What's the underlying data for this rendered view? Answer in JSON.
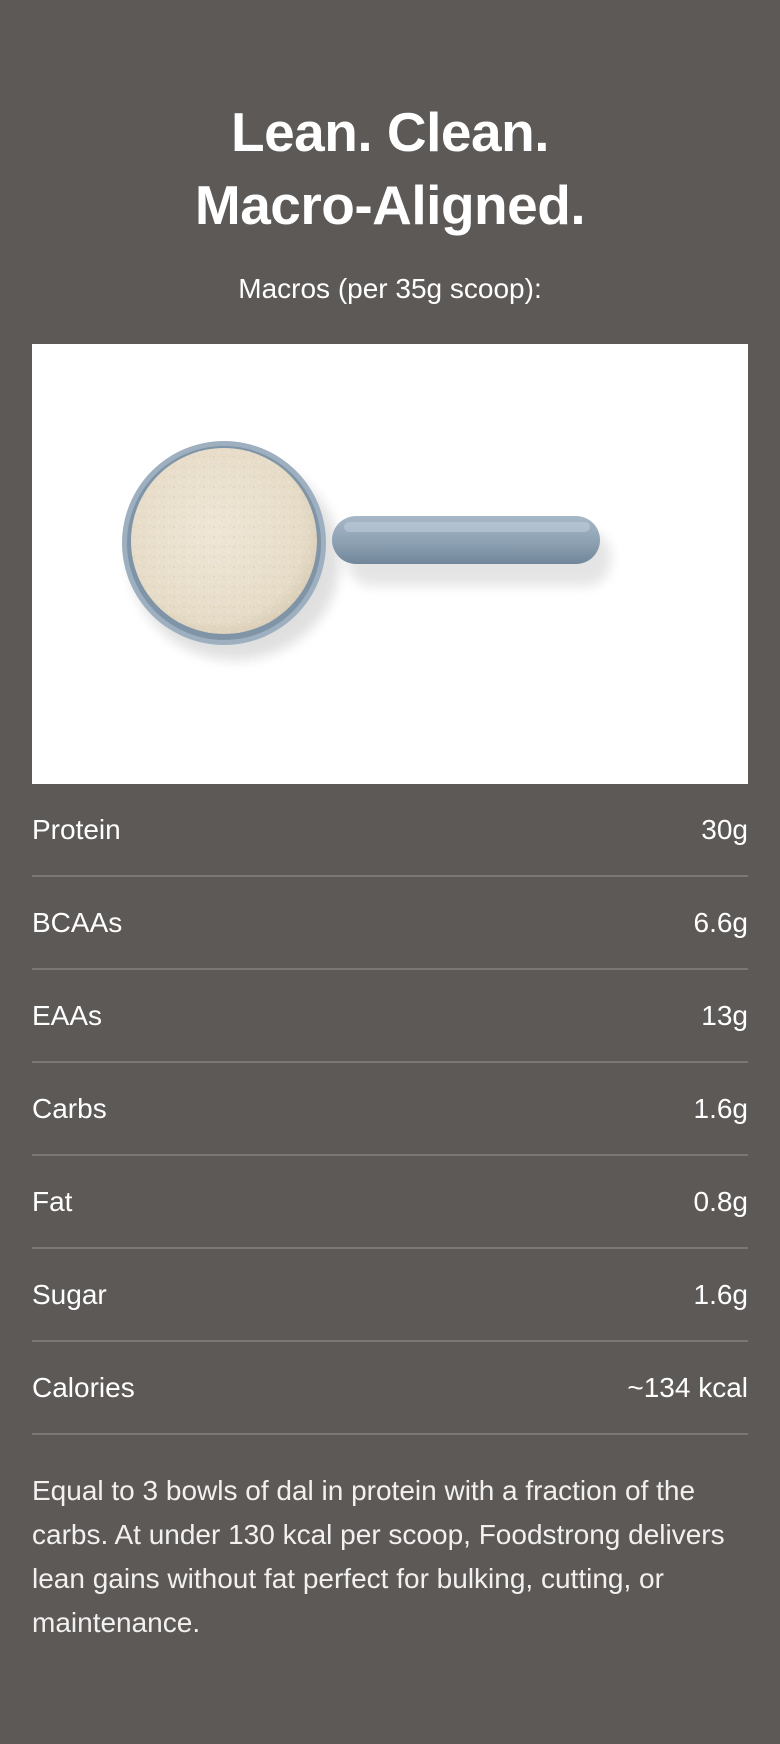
{
  "heading": {
    "line1": "Lean. Clean.",
    "line2": "Macro-Aligned."
  },
  "subheading": "Macros (per 35g scoop):",
  "image": {
    "icon": "protein-scoop-icon",
    "colors": {
      "powder": "#e9dfcc",
      "scoop": "#8da1b3"
    }
  },
  "macros": [
    {
      "label": "Protein",
      "value": "30g"
    },
    {
      "label": "BCAAs",
      "value": "6.6g"
    },
    {
      "label": "EAAs",
      "value": "13g"
    },
    {
      "label": "Carbs",
      "value": "1.6g"
    },
    {
      "label": "Fat",
      "value": "0.8g"
    },
    {
      "label": "Sugar",
      "value": "1.6g"
    },
    {
      "label": "Calories",
      "value": "~134 kcal"
    }
  ],
  "description": "Equal to 3 bowls of dal in protein with a fraction of the carbs. At under 130 kcal per scoop, Foodstrong delivers lean gains without fat perfect for bulking, cutting, or maintenance.",
  "colors": {
    "background": "#5c5957",
    "divider": "#7a7775",
    "text": "#ffffff"
  }
}
